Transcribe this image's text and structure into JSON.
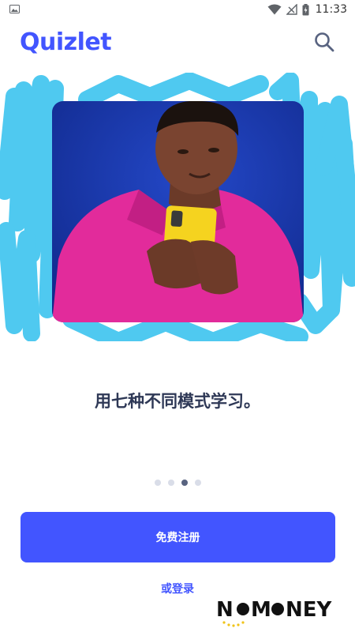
{
  "status_bar": {
    "time": "11:33",
    "icons": [
      "gallery-notification-icon",
      "wifi-icon",
      "signal-icon",
      "battery-charging-icon"
    ]
  },
  "header": {
    "logo_text": "Quizlet",
    "search_icon": "search-icon"
  },
  "onboarding": {
    "headline": "用七种不同模式学习。",
    "pager": {
      "total": 4,
      "active_index": 2
    }
  },
  "actions": {
    "signup_label": "免费注册",
    "login_label": "或登录"
  },
  "watermark": {
    "text": "NOMONEY"
  },
  "colors": {
    "brand": "#4255ff",
    "logo": "#4255ff",
    "headline": "#2e3856",
    "dot_inactive": "#d9dde8",
    "dot_active": "#586380",
    "scribble": "#4fc9f0",
    "photo_bg": "#1838a8",
    "hoodie": "#e22b9b",
    "phone": "#f5d31f",
    "login": "#4255ff"
  }
}
